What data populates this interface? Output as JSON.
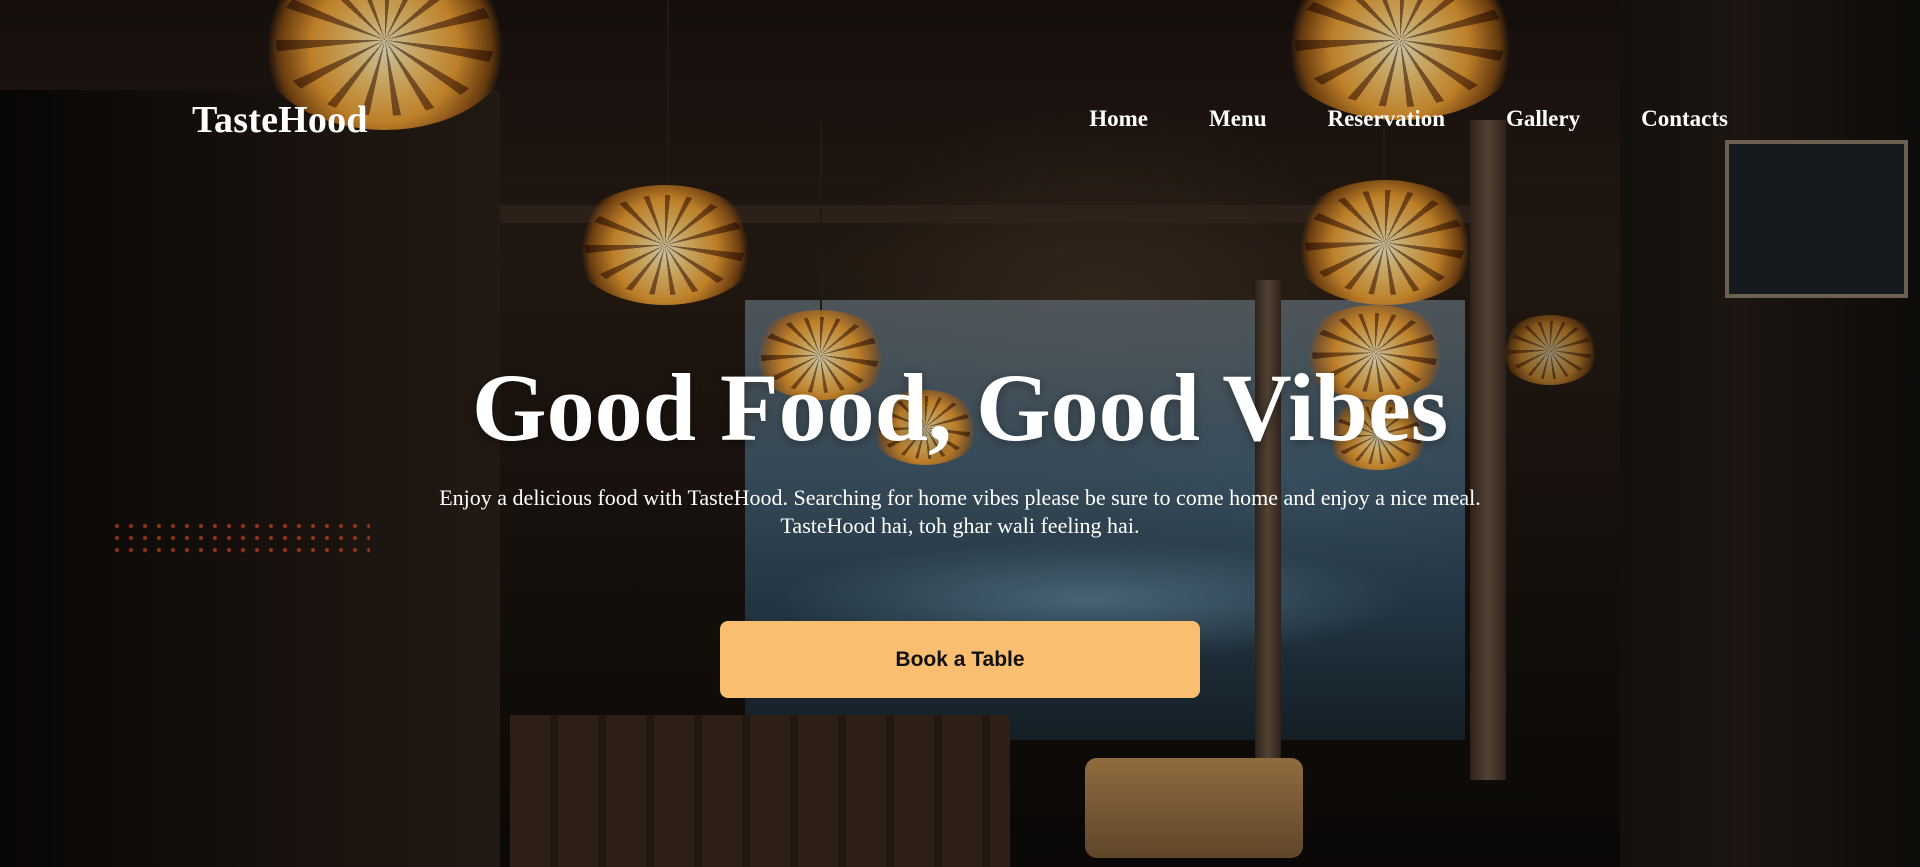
{
  "brand": {
    "name": "TasteHood"
  },
  "nav": {
    "items": [
      {
        "label": "Home"
      },
      {
        "label": "Menu"
      },
      {
        "label": "Reservation"
      },
      {
        "label": "Gallery"
      },
      {
        "label": "Contacts"
      }
    ]
  },
  "hero": {
    "headline": "Good Food, Good Vibes",
    "tagline_line1": "Enjoy a delicious food with TasteHood. Searching for home vibes please be sure to come home and enjoy a nice meal.",
    "tagline_line2": "TasteHood hai, toh ghar wali feeling hai.",
    "cta_label": "Book a Table",
    "background_image": "dim restaurant interior with glowing orange pendant lamps"
  },
  "colors": {
    "cta_background": "#f9be70",
    "text": "#ffffff",
    "cta_text": "#111111"
  }
}
